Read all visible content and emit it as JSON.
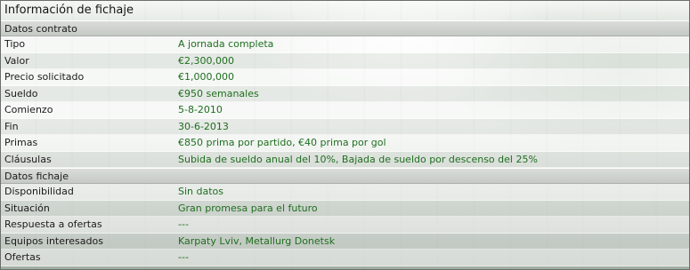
{
  "title": "Información de fichaje",
  "sections": [
    {
      "heading": "Datos contrato",
      "rows": [
        {
          "label": "Tipo",
          "value": "A jornada completa"
        },
        {
          "label": "Valor",
          "value": "€2,300,000"
        },
        {
          "label": "Precio solicitado",
          "value": "€1,000,000"
        },
        {
          "label": "Sueldo",
          "value": "€950 semanales"
        },
        {
          "label": "Comienzo",
          "value": "5-8-2010"
        },
        {
          "label": "Fin",
          "value": "30-6-2013"
        },
        {
          "label": "Primas",
          "value": "€850 prima por partido, €40 prima por gol"
        },
        {
          "label": "Cláusulas",
          "value": "Subida de sueldo anual del 10%, Bajada de sueldo por descenso del 25%"
        }
      ]
    },
    {
      "heading": "Datos fichaje",
      "rows": [
        {
          "label": "Disponibilidad",
          "value": "Sin datos"
        },
        {
          "label": "Situación",
          "value": "Gran promesa para el futuro"
        },
        {
          "label": "Respuesta a ofertas",
          "value": "---"
        },
        {
          "label": "Equipos interesados",
          "value": "Karpaty Lviv, Metallurg Donetsk"
        },
        {
          "label": "Ofertas",
          "value": "---"
        }
      ]
    }
  ],
  "colors": {
    "value_text": "#1f6e1f",
    "label_text": "#1a1a1a",
    "section_bg": "#c6cac6"
  }
}
